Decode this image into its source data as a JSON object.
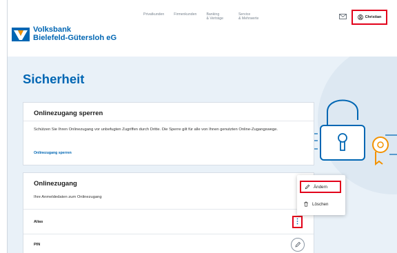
{
  "topnav": {
    "items": [
      {
        "label": "Privatkunden"
      },
      {
        "label": "Firmenkunden"
      },
      {
        "label": "Banking\n& Verträge"
      },
      {
        "label": "Service\n& Mehrwerte"
      }
    ]
  },
  "header": {
    "user_label": "Christian",
    "bank_name_line1": "Volksbank",
    "bank_name_line2": "Bielefeld-Gütersloh eG"
  },
  "page": {
    "title": "Sicherheit"
  },
  "card_lock": {
    "title": "Onlinezugang sperren",
    "text": "Schützen Sie Ihren Onlinezugang vor unbefugten Zugriffen durch Dritte. Die Sperre gilt für alle von Ihnen genutzten Online-Zugangswege.",
    "link": "Onlinezugang sperren"
  },
  "card_access": {
    "title": "Onlinezugang",
    "subtitle": "Ihre Anmeldedaten zum Onlinezugang",
    "rows": [
      {
        "label": "Alias"
      },
      {
        "label": "PIN"
      }
    ],
    "kebab": "⋮"
  },
  "menu": {
    "edit_label": "Ändern",
    "delete_label": "Löschen"
  },
  "colors": {
    "brand_blue": "#0066b3",
    "brand_orange": "#f39200",
    "highlight_red": "#e2001a",
    "band_bg": "#e9f1f8"
  },
  "icons": [
    "mail-icon",
    "user-icon",
    "padlock-illustration",
    "pencil-icon",
    "trash-icon",
    "more-vertical-icon"
  ]
}
